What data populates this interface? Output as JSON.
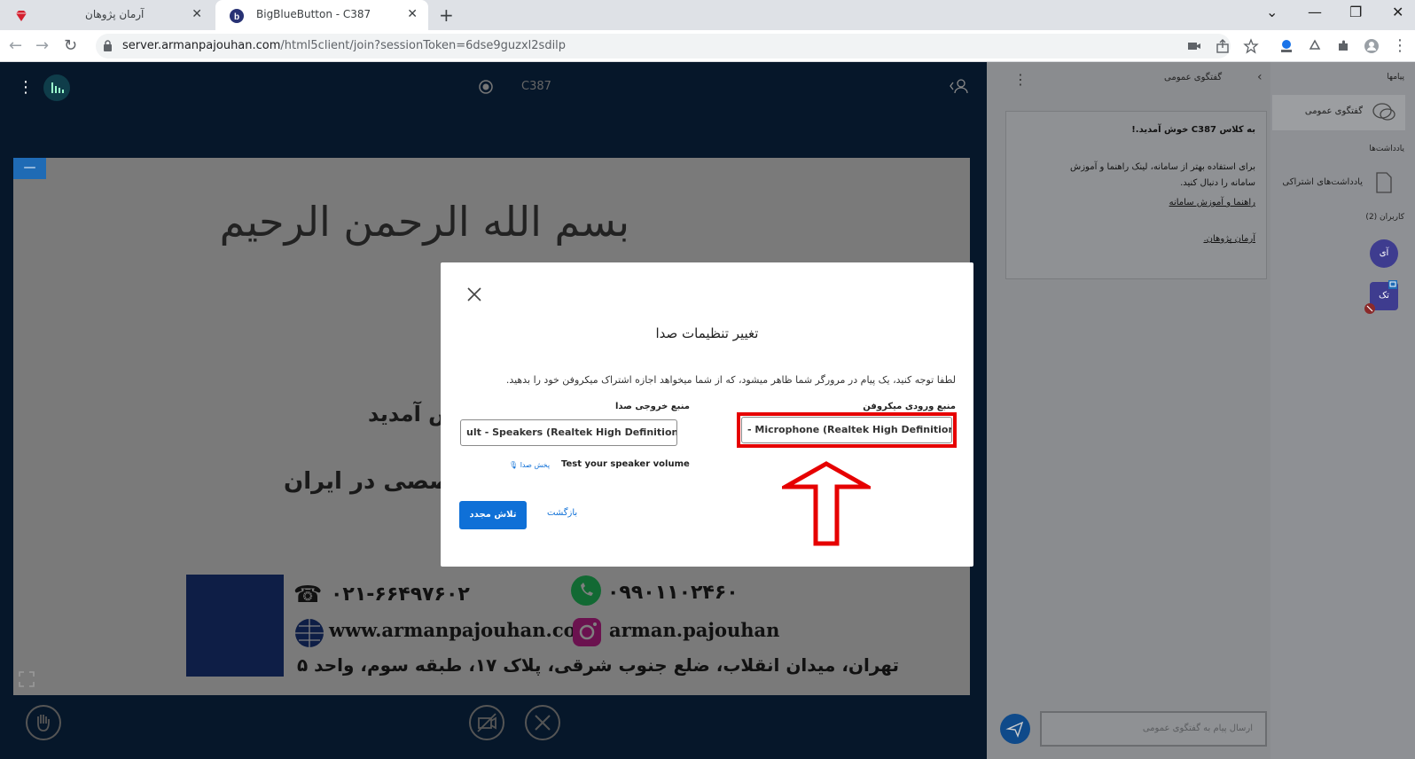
{
  "browser": {
    "tabs": [
      {
        "title": "آرمان پژوهان",
        "active": false
      },
      {
        "title": "BigBlueButton - C387",
        "active": true
      }
    ],
    "url_host": "server.armanpajouhan.com",
    "url_path": "/html5client/join?sessionToken=6dse9guzxl2sdilp"
  },
  "meeting": {
    "title": "C387",
    "minimize_label": "—"
  },
  "slide": {
    "basmala": "بسم الله الرحمن الرحیم",
    "welcome": "ش آمدید",
    "subtitle": "خصصی در ایران",
    "phone": "۰۲۱-۶۶۴۹۷۶۰۲",
    "mobile": "۰۹۹۰۱۱۰۲۴۶۰",
    "website": "www.armanpajouhan.com",
    "instagram": "arman.pajouhan",
    "address": "تهران، میدان انقلاب، ضلع جنوب شرقی، پلاک ۱۷، طبقه سوم، واحد ۵"
  },
  "sidebar": {
    "messages_heading": "پیامها",
    "public_chat": "گفتگوی عمومی",
    "notes_heading": "یادداشت‌ها",
    "shared_notes": "یادداشت‌های اشتراکی",
    "users_heading": "کاربران (2)",
    "user1_initials": "آی",
    "user2_initials": "تک"
  },
  "chat": {
    "header": "گفتگوی عمومی",
    "welcome_line": "به کلاس C387 خوش آمدید.!",
    "body_line1": "برای استفاده بهتر از سامانه، لینک راهنما و آموزش",
    "body_line2": "سامانه را دنبال کنید.",
    "link1": "راهنما و آموزش سامانه",
    "link2": "آرمان پژوهان.",
    "input_placeholder": "ارسال پیام به گفتگوی عمومی"
  },
  "modal": {
    "title": "تغییر تنظیمات صدا",
    "note": "لطفا توجه کنید، یک پیام در مرورگر شما ظاهر میشود، که از شما میخواهد اجازه اشتراک میکروفن خود را بدهید.",
    "mic_label": "منبع ورودی میکروفن",
    "mic_value": "- Microphone (Realtek High Definition Audio)",
    "speaker_label": "منبع خروجی صدا",
    "speaker_value": "ult - Speakers (Realtek High Definition Audio)",
    "test_speaker": "Test your speaker volume",
    "play_sound": "پخش صدا",
    "retry_button": "تلاش مجدد",
    "back_link": "بازگشت"
  },
  "colors": {
    "highlight": "#e60000",
    "primary": "#0f70d7",
    "dark_bg": "#06172a"
  }
}
